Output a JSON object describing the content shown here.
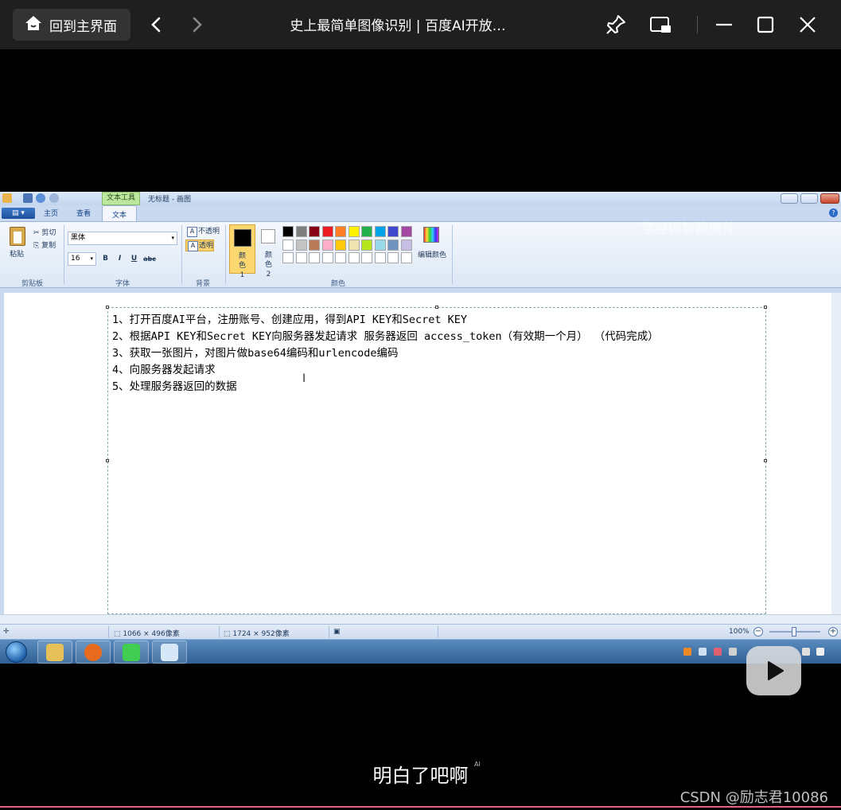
{
  "player": {
    "home_label": "回到主界面",
    "video_title": "史上最简单图像识别 | 百度AI开放…",
    "subtitle": "明白了吧啊",
    "ai_tag": "AI",
    "credit": "CSDN @励志君10086",
    "watermark": "学益得智能硬件"
  },
  "paint": {
    "context_tab": "文本工具",
    "window_title": "无标题 - 画图",
    "tabs": [
      "主页",
      "查看",
      "文本"
    ],
    "clipboard": {
      "paste": "粘贴",
      "cut": "剪切",
      "copy": "复制",
      "group": "剪贴板"
    },
    "font": {
      "family": "黑体",
      "size": "16",
      "group": "字体",
      "bold": "B",
      "italic": "I",
      "underline": "U",
      "strike": "abc"
    },
    "background": {
      "opaque": "不透明",
      "transparent": "透明",
      "group": "背景"
    },
    "colors": {
      "color1_label": "颜色 1",
      "color2_label": "颜色 2",
      "edit_label": "编辑颜色",
      "group": "颜色",
      "palette_row1": [
        "#000000",
        "#7f7f7f",
        "#880015",
        "#ed1c24",
        "#ff7f27",
        "#fff200",
        "#22b14c",
        "#00a2e8",
        "#3f48cc",
        "#a349a4"
      ],
      "palette_row2": [
        "#ffffff",
        "#c3c3c3",
        "#b97a57",
        "#ffaec9",
        "#ffc90e",
        "#efe4b0",
        "#b5e61d",
        "#99d9ea",
        "#7092be",
        "#c8bfe7"
      ]
    },
    "text_lines": [
      "1、打开百度AI平台，注册账号、创建应用，得到API KEY和Secret KEY",
      "2、根据API KEY和Secret KEY向服务器发起请求 服务器返回 access_token（有效期一个月） （代码完成）",
      "3、获取一张图片，对图片做base64编码和urlencode编码",
      "4、向服务器发起请求",
      "5、处理服务器返回的数据"
    ],
    "status": {
      "selection_size": "1066 × 496像素",
      "image_size": "1724 × 952像素",
      "zoom": "100%"
    }
  }
}
